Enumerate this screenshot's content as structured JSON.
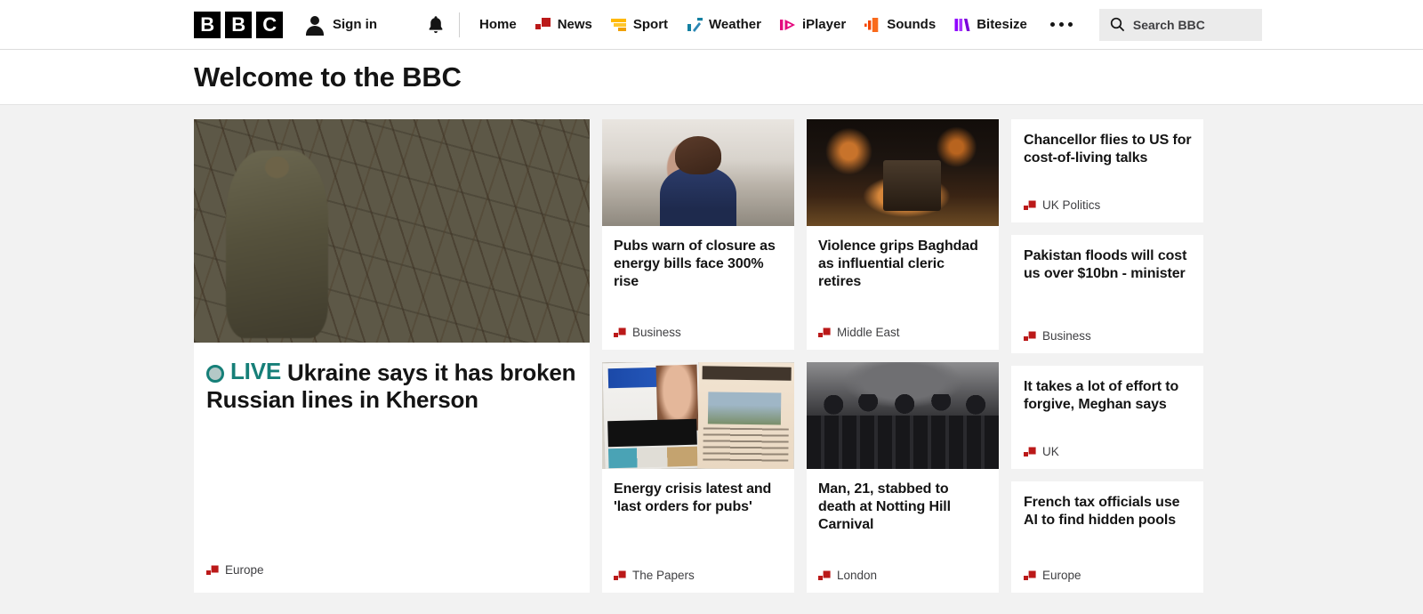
{
  "nav": {
    "logo_letters": [
      "B",
      "B",
      "C"
    ],
    "sign_in_label": "Sign in",
    "notifications_icon": "bell-icon",
    "account_icon": "person-icon",
    "more_icon": "ellipsis-icon",
    "links": [
      {
        "label": "Home",
        "icon": ""
      },
      {
        "label": "News",
        "icon": "bbc-news-icon"
      },
      {
        "label": "Sport",
        "icon": "bbc-sport-icon"
      },
      {
        "label": "Weather",
        "icon": "bbc-weather-icon"
      },
      {
        "label": "iPlayer",
        "icon": "bbc-iplayer-icon"
      },
      {
        "label": "Sounds",
        "icon": "bbc-sounds-icon"
      },
      {
        "label": "Bitesize",
        "icon": "bbc-bitesize-icon"
      }
    ],
    "search": {
      "placeholder": "Search BBC",
      "value": "",
      "icon": "search-icon"
    }
  },
  "banner": {
    "title": "Welcome to the BBC"
  },
  "colors": {
    "bbc_red": "#bb1919",
    "live_teal": "#167f78",
    "sport_yellow": "#ffb800",
    "weather_blue": "#1380a1",
    "iplayer_pink": "#e4097e",
    "sounds_orange": "#f54600",
    "bitesize_purple": "#8f00ff",
    "page_bg": "#f2f2f2",
    "card_bg": "#ffffff",
    "text": "#141414",
    "muted_text": "#3f3f42"
  },
  "lead_story": {
    "live_label": "LIVE",
    "headline": "Ukraine says it has broken Russian lines in Kherson",
    "category": "Europe",
    "image": "ukraine-soldier-artillery-photo"
  },
  "column_two": [
    {
      "headline": "Pubs warn of closure as energy bills face 300% rise",
      "category": "Business",
      "image": "stressed-pub-landlady-photo"
    },
    {
      "headline": "Energy crisis latest and 'last orders for pubs'",
      "category": "The Papers",
      "image": "newspaper-front-pages-photo"
    }
  ],
  "column_three": [
    {
      "headline": "Violence grips Baghdad as influential cleric retires",
      "category": "Middle East",
      "image": "baghdad-night-violence-photo"
    },
    {
      "headline": "Man, 21, stabbed to death at Notting Hill Carnival",
      "category": "London",
      "image": "police-officers-line-photo"
    }
  ],
  "column_four": [
    {
      "headline": "Chancellor flies to US for cost-of-living talks",
      "category": "UK Politics"
    },
    {
      "headline": "Pakistan floods will cost us over $10bn - minister",
      "category": "Business"
    },
    {
      "headline": "It takes a lot of effort to forgive, Meghan says",
      "category": "UK"
    },
    {
      "headline": "French tax officials use AI to find hidden pools",
      "category": "Europe"
    }
  ]
}
